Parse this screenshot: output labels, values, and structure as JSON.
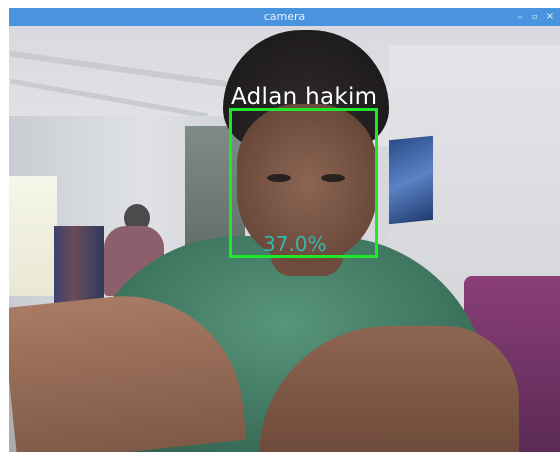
{
  "window": {
    "title": "camera",
    "controls": {
      "minimize": "–",
      "maximize": "▫",
      "close": "×"
    },
    "titlebar_color": "#4a94df"
  },
  "camera_feed": {
    "detection": {
      "name": "Adlan hakim",
      "confidence": "37.0%",
      "box_color": "#22e62a",
      "name_color": "#ffffff",
      "confidence_color": "#35b8ab"
    }
  }
}
